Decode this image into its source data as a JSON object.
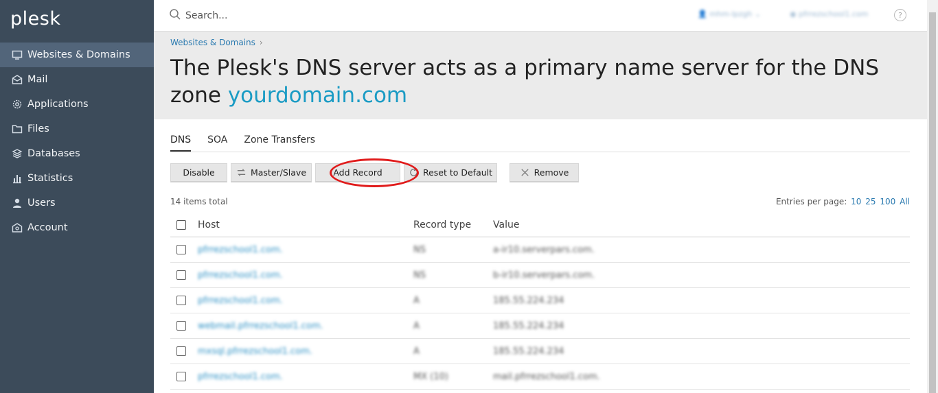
{
  "brand": {
    "logo": "plesk"
  },
  "sidebar": {
    "items": [
      {
        "label": "Websites & Domains",
        "icon": "monitor-icon",
        "active": true
      },
      {
        "label": "Mail",
        "icon": "mail-icon",
        "active": false
      },
      {
        "label": "Applications",
        "icon": "gear-icon",
        "active": false
      },
      {
        "label": "Files",
        "icon": "folder-icon",
        "active": false
      },
      {
        "label": "Databases",
        "icon": "database-icon",
        "active": false
      },
      {
        "label": "Statistics",
        "icon": "bar-chart-icon",
        "active": false
      },
      {
        "label": "Users",
        "icon": "user-icon",
        "active": false
      },
      {
        "label": "Account",
        "icon": "account-icon",
        "active": false
      }
    ]
  },
  "topbar": {
    "search_placeholder": "Search...",
    "user_name": "mhm-lpzgh",
    "site_name": "pfrrezschool1.com"
  },
  "header": {
    "breadcrumb": "Websites & Domains",
    "title_prefix": "The Plesk's DNS server acts as a primary name server for the DNS zone ",
    "title_domain": "yourdomain.com"
  },
  "tabs": [
    {
      "label": "DNS",
      "active": true
    },
    {
      "label": "SOA",
      "active": false
    },
    {
      "label": "Zone Transfers",
      "active": false
    }
  ],
  "toolbar": {
    "disable": "Disable",
    "master_slave": "Master/Slave",
    "add_record": "Add Record",
    "reset": "Reset to Default",
    "remove": "Remove"
  },
  "list": {
    "total": "14 items total",
    "entries_label": "Entries per page:",
    "page_sizes": [
      "10",
      "25",
      "100",
      "All"
    ]
  },
  "table": {
    "columns": [
      "Host",
      "Record type",
      "Value"
    ],
    "rows": [
      {
        "host": "pfrrezschool1.com.",
        "type": "NS",
        "value": "a-ir10.serverpars.com."
      },
      {
        "host": "pfrrezschool1.com.",
        "type": "NS",
        "value": "b-ir10.serverpars.com."
      },
      {
        "host": "pfrrezschool1.com.",
        "type": "A",
        "value": "185.55.224.234"
      },
      {
        "host": "webmail.pfrrezschool1.com.",
        "type": "A",
        "value": "185.55.224.234"
      },
      {
        "host": "mxsql.pfrrezschool1.com.",
        "type": "A",
        "value": "185.55.224.234"
      },
      {
        "host": "pfrrezschool1.com.",
        "type": "MX (10)",
        "value": "mail.pfrrezschool1.com."
      }
    ]
  },
  "colors": {
    "sidebar_bg": "#3c4b5a",
    "sidebar_active": "#52657a",
    "link": "#2a7ab0",
    "domain_accent": "#1a9bc4",
    "highlight_ring": "#e01b1b"
  }
}
